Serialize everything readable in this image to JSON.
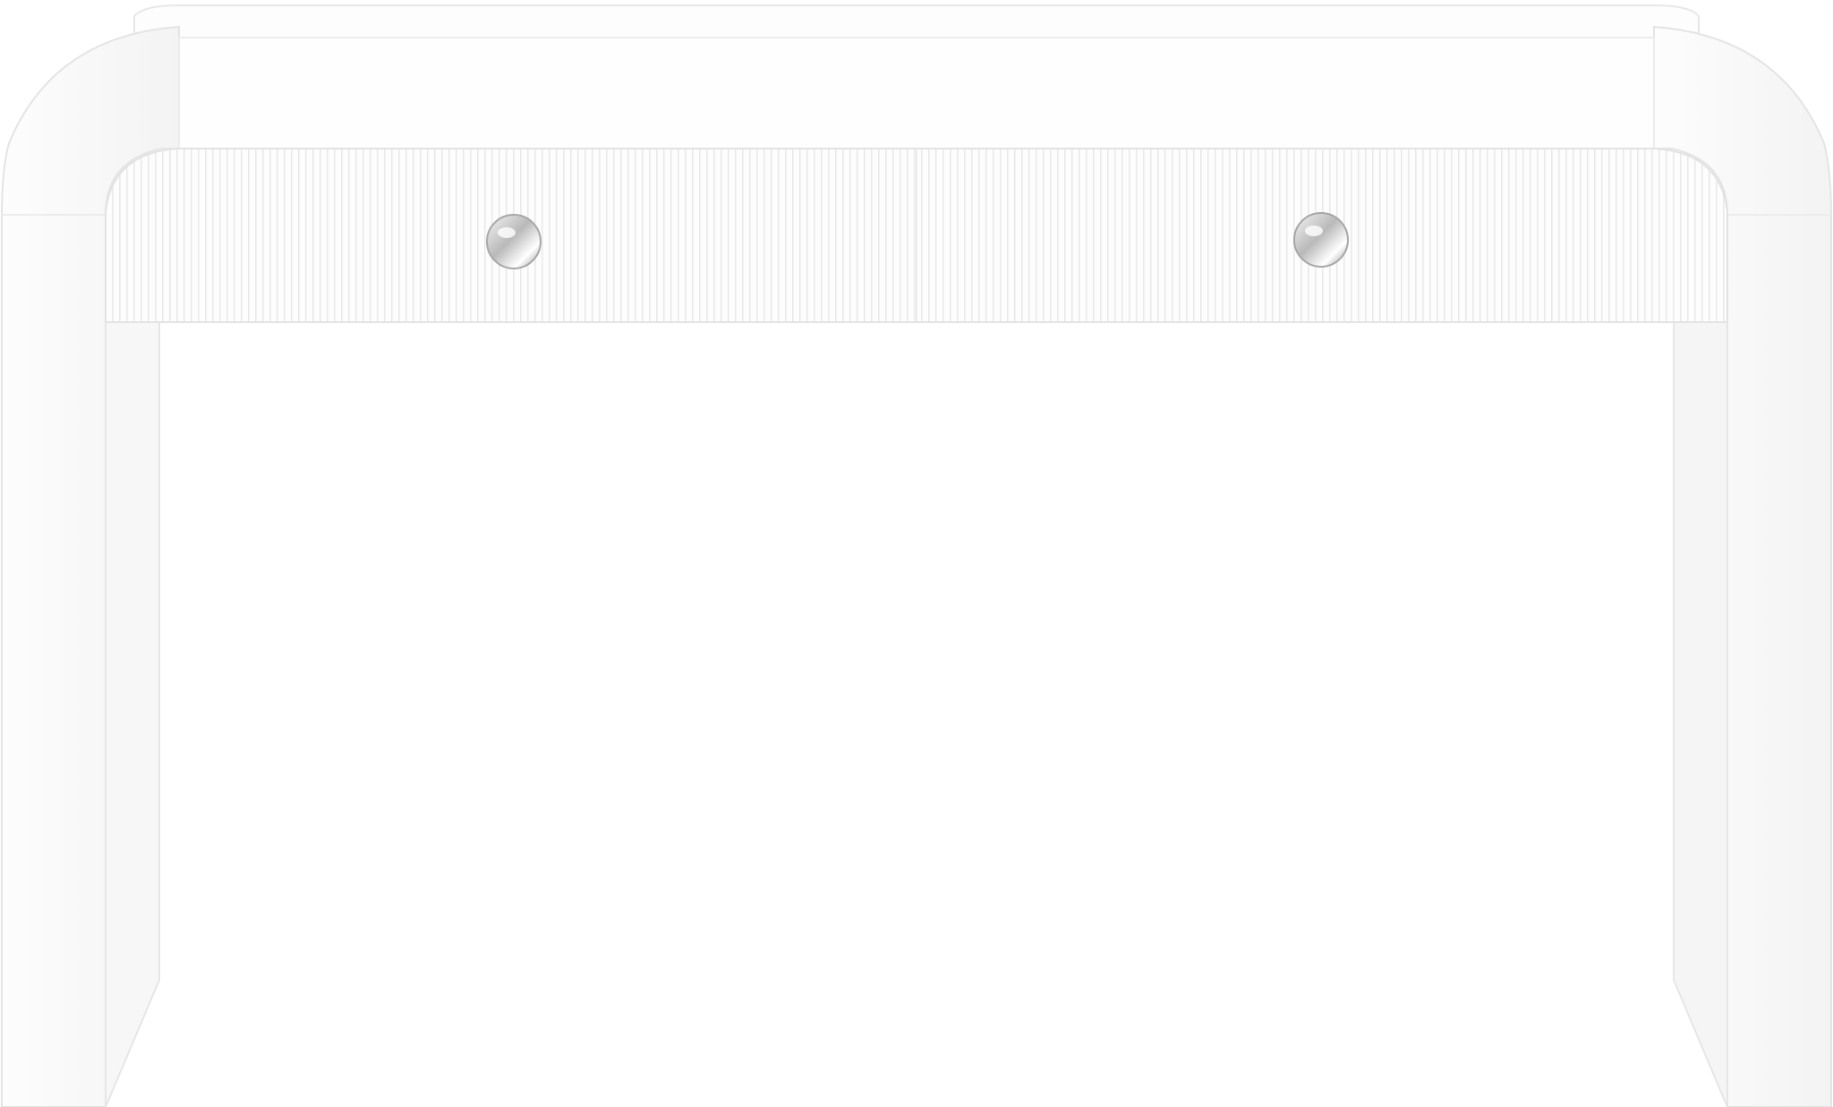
{
  "image": {
    "subject": "",
    "background_color": "#ffffff"
  },
  "product": {
    "finish_color": "#fbfbfb",
    "edge_color": "#e6e6e6",
    "shadow_color": "#ececec",
    "hardware_color": "#c9c9c9",
    "drawer_count": 2,
    "knob_count": 2,
    "icons": {
      "knob": "round-knob-icon",
      "leg": "waterfall-leg"
    }
  }
}
